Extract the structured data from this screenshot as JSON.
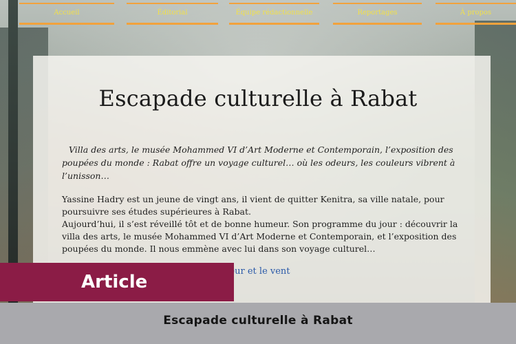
{
  "nav": {
    "items": [
      {
        "label": "Accueil"
      },
      {
        "label": "Éditorial"
      },
      {
        "label": "Équipe rédactionnelle"
      },
      {
        "label": "Reportages"
      },
      {
        "label": "À propos"
      }
    ]
  },
  "article": {
    "title": "Escapade culturelle à Rabat",
    "intro": "Villa des arts, le musée Mohammed VI d’Art Moderne et Contemporain, l’exposition des poupées du monde : Rabat offre un voyage culturel… où les odeurs, les couleurs vibrent à l’unisson…",
    "paragraphs": [
      "Yassine Hadry est un jeune de vingt ans, il vient de quitter Kenitra, sa ville natale, pour poursuivre ses études supérieures à Rabat.",
      "Aujourd’hui, il s’est réveillé tôt et de bonne humeur. Son programme du jour : découvrir la villa des arts, le musée Mohammed VI d’Art Moderne et Contemporain, et l’exposition des poupées du monde. Il nous emmène avec lui dans son voyage culturel…"
    ],
    "subheading": "el où les odeurs, les couleurs, la chaleur et le vent"
  },
  "badge": {
    "label": "Article"
  },
  "footer": {
    "title": "Escapade culturelle à Rabat"
  },
  "colors": {
    "nav_border": "#f2a23c",
    "nav_text": "#f2e04a",
    "badge_bg": "#8b1c46",
    "footer_bg": "#a9a9ad",
    "subheading": "#2a59a8"
  }
}
